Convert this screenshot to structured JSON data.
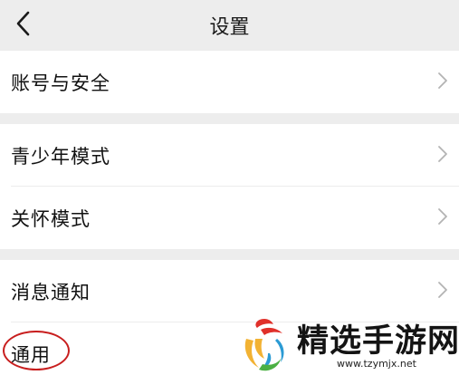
{
  "header": {
    "title": "设置"
  },
  "groups": [
    {
      "items": [
        {
          "label": "账号与安全"
        }
      ]
    },
    {
      "items": [
        {
          "label": "青少年模式"
        },
        {
          "label": "关怀模式"
        }
      ]
    },
    {
      "items": [
        {
          "label": "消息通知"
        },
        {
          "label": "通用"
        }
      ]
    }
  ],
  "watermark": {
    "name": "精选手游网",
    "url": "www.tzymjx.net"
  },
  "colors": {
    "background": "#ededed",
    "card": "#ffffff",
    "annotation": "#c81e1e"
  }
}
